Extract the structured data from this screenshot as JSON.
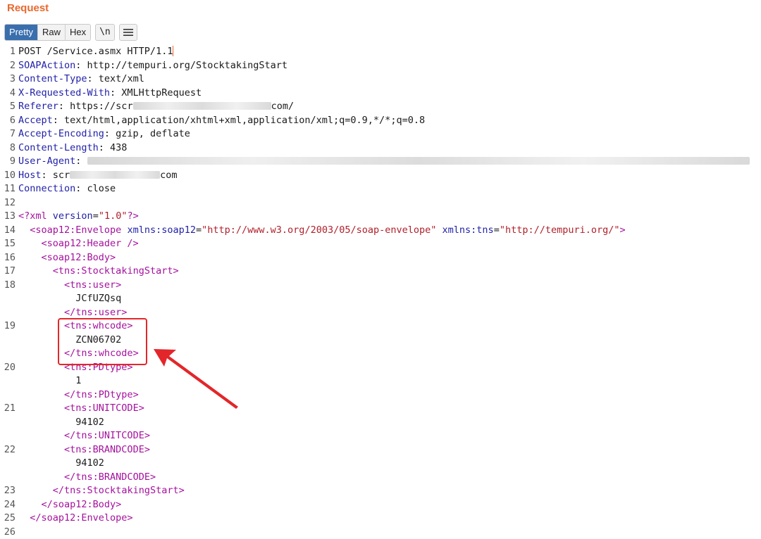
{
  "panel": {
    "title": "Request"
  },
  "toolbar": {
    "pretty": "Pretty",
    "raw": "Raw",
    "hex": "Hex",
    "newline": "\\n"
  },
  "lines": [
    {
      "n": "1",
      "html": "<span>POST /Service.asmx HTTP/1.1</span><span class=\"cursor\"></span>"
    },
    {
      "n": "2",
      "html": "<span class=\"k\">SOAPAction</span>: http://tempuri.org/StocktakingStart"
    },
    {
      "n": "3",
      "html": "<span class=\"k\">Content-Type</span>: text/xml"
    },
    {
      "n": "4",
      "html": "<span class=\"k\">X-Requested-With</span>: XMLHttpRequest"
    },
    {
      "n": "5",
      "html": "<span class=\"k\">Referer</span>: https://scr<span class=\"blur\" style=\"width:196px\"></span>com/"
    },
    {
      "n": "6",
      "html": "<span class=\"k\">Accept</span>: text/html,application/xhtml+xml,application/xml;q=0.9,*/*;q=0.8"
    },
    {
      "n": "7",
      "html": "<span class=\"k\">Accept-Encoding</span>: gzip, deflate"
    },
    {
      "n": "8",
      "html": "<span class=\"k\">Content-Length</span>: 438"
    },
    {
      "n": "9",
      "html": "<span class=\"k\">User-Agent</span>: <span class=\"blur\" style=\"width:940px\"></span>"
    },
    {
      "n": "10",
      "html": "<span class=\"k\">Host</span>: scr<span class=\"blur\" style=\"width:128px\"></span>com"
    },
    {
      "n": "11",
      "html": "<span class=\"k\">Connection</span>: close"
    },
    {
      "n": "12",
      "html": ""
    },
    {
      "n": "13",
      "html": "<span class=\"t\">&lt;?xml</span> <span class=\"a\">version</span>=<span class=\"s\">\"1.0\"</span><span class=\"t\">?&gt;</span>"
    },
    {
      "n": "14",
      "html": "  <span class=\"t\">&lt;soap12:Envelope</span> <span class=\"a\">xmlns:soap12</span>=<span class=\"s\">\"http://www.w3.org/2003/05/soap-envelope\"</span> <span class=\"a\">xmlns:tns</span>=<span class=\"s\">\"http://tempuri.org/\"</span><span class=\"t\">&gt;</span>"
    },
    {
      "n": "15",
      "html": "    <span class=\"t\">&lt;soap12:Header /&gt;</span>"
    },
    {
      "n": "16",
      "html": "    <span class=\"t\">&lt;soap12:Body&gt;</span>"
    },
    {
      "n": "17",
      "html": "      <span class=\"t\">&lt;tns:StocktakingStart&gt;</span>"
    },
    {
      "n": "18",
      "html": "        <span class=\"t\">&lt;tns:user&gt;</span>"
    },
    {
      "n": "",
      "html": "          JCfUZQsq"
    },
    {
      "n": "",
      "html": "        <span class=\"t\">&lt;/tns:user&gt;</span>"
    },
    {
      "n": "19",
      "html": "        <span class=\"t\">&lt;tns:whcode&gt;</span>"
    },
    {
      "n": "",
      "html": "          ZCN06702"
    },
    {
      "n": "",
      "html": "        <span class=\"t\">&lt;/tns:whcode&gt;</span>"
    },
    {
      "n": "20",
      "html": "        <span class=\"t\">&lt;tns:PDtype&gt;</span>"
    },
    {
      "n": "",
      "html": "          1"
    },
    {
      "n": "",
      "html": "        <span class=\"t\">&lt;/tns:PDtype&gt;</span>"
    },
    {
      "n": "21",
      "html": "        <span class=\"t\">&lt;tns:UNITCODE&gt;</span>"
    },
    {
      "n": "",
      "html": "          94102"
    },
    {
      "n": "",
      "html": "        <span class=\"t\">&lt;/tns:UNITCODE&gt;</span>"
    },
    {
      "n": "22",
      "html": "        <span class=\"t\">&lt;tns:BRANDCODE&gt;</span>"
    },
    {
      "n": "",
      "html": "          94102"
    },
    {
      "n": "",
      "html": "        <span class=\"t\">&lt;/tns:BRANDCODE&gt;</span>"
    },
    {
      "n": "23",
      "html": "      <span class=\"t\">&lt;/tns:StocktakingStart&gt;</span>"
    },
    {
      "n": "24",
      "html": "    <span class=\"t\">&lt;/soap12:Body&gt;</span>"
    },
    {
      "n": "25",
      "html": "  <span class=\"t\">&lt;/soap12:Envelope&gt;</span>"
    },
    {
      "n": "26",
      "html": ""
    }
  ],
  "colors": {
    "title": "#e8692e",
    "active_tab": "#3a6fae",
    "annotation": "#e3262a"
  }
}
